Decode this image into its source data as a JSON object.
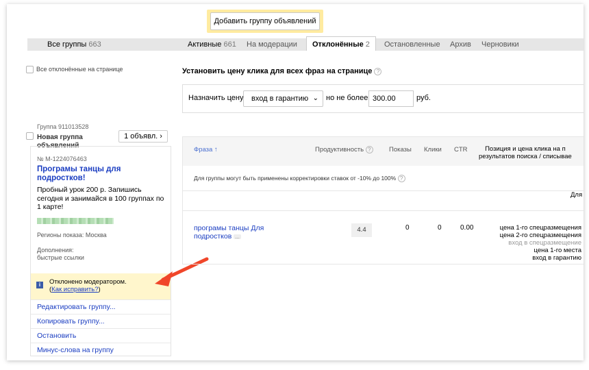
{
  "toolbar": {
    "add_group_label": "Добавить группу объявлений"
  },
  "tabs": [
    {
      "label": "Все группы",
      "count": "663"
    },
    {
      "label": "Активные",
      "count": "661"
    },
    {
      "label": "На модерации",
      "count": ""
    },
    {
      "label": "Отклонённые",
      "count": "2"
    },
    {
      "label": "Остановленные",
      "count": ""
    },
    {
      "label": "Архив",
      "count": ""
    },
    {
      "label": "Черновики",
      "count": ""
    }
  ],
  "select_all": {
    "label": "Все отклонённые на странице"
  },
  "bulk_price": {
    "title": "Установить цену клика для всех фраз на странице",
    "assign_label": "Назначить цену",
    "strategy_value": "вход в гарантию",
    "max_label": "но не более",
    "price_value": "300.00",
    "currency": "руб."
  },
  "group": {
    "number": "Группа 911013528",
    "name": "Новая группа объявлений",
    "ads_button": "1 объявл.",
    "ad": {
      "number": "№ M-1224076463",
      "title": "Програмы танцы для подростков!",
      "text": "Пробный урок 200 р. Запишись сегодня и занимайся в 100 группах по 1 карте!",
      "regions": "Регионы показа: Москва",
      "extras_label": "Дополнения:",
      "extras_value": "быстрые ссылки"
    },
    "rejected": {
      "message": "Отклонено модератором.",
      "link_open": "(",
      "link": "Как исправить?",
      "link_close": ")"
    },
    "actions": {
      "edit": "Редактировать группу...",
      "copy": "Копировать группу...",
      "stop": "Остановить",
      "minus_words": "Минус-слова на группу"
    }
  },
  "table": {
    "headers": {
      "phrase": "Фраза",
      "sort_arrow": "↑",
      "productivity": "Продуктивность",
      "shows": "Показы",
      "clicks": "Клики",
      "ctr": "CTR",
      "position_line1": "Позиция и цена клика на п",
      "position_line2": "результатов поиска / списывае"
    },
    "note": "Для группы могут быть применены корректировки ставок от -10% до 100%",
    "for_label": "Для",
    "row": {
      "phrase": "програмы танцы Для подростков",
      "productivity": "4.4",
      "shows": "0",
      "clicks": "0",
      "ctr": "0.00",
      "bid_line1": "цена 1-го спецразмещения",
      "bid_line2": "цена 2-го спецразмещения",
      "bid_line3": "вход в спецразмещение",
      "bid_line4": "цена 1-го места",
      "bid_line5": "вход в гарантию"
    }
  },
  "icons": {
    "help": "?",
    "info": "i",
    "chevron_right": "›",
    "chevron_down": "⌄",
    "more_dots": "..."
  },
  "colors": {
    "link": "#1a3dc1",
    "highlight": "#ffeba0",
    "arrow": "#f0462a",
    "rejected_bg": "#fff6cc"
  }
}
